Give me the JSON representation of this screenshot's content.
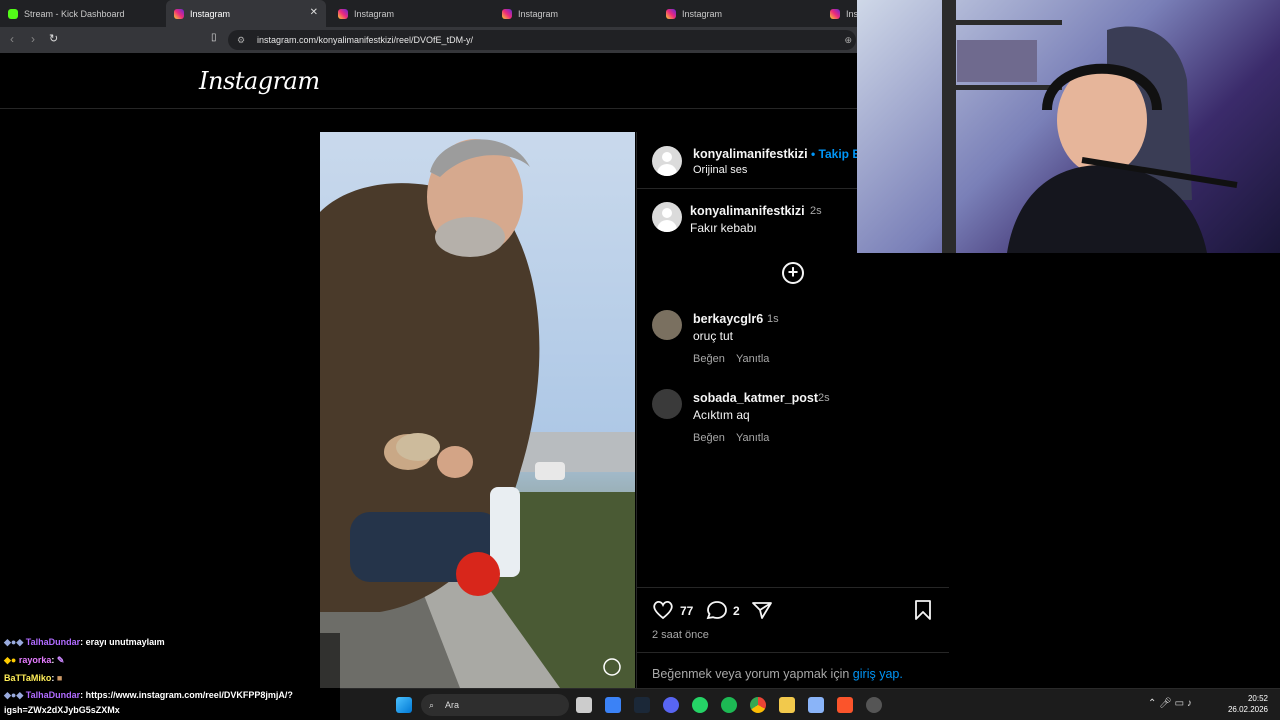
{
  "browser": {
    "tabs": [
      {
        "label": "Stream - Kick Dashboard",
        "icon": "kick-icon"
      },
      {
        "label": "Instagram",
        "icon": "instagram-icon"
      },
      {
        "label": "Instagram",
        "icon": "instagram-icon"
      },
      {
        "label": "Instagram",
        "icon": "instagram-icon"
      },
      {
        "label": "Instagram",
        "icon": "instagram-icon"
      },
      {
        "label": "Insta",
        "icon": "instagram-icon"
      }
    ],
    "active_tab_index": 1,
    "url": "instagram.com/konyalimanifestkizi/reel/DVOfE_tDM-y/"
  },
  "instagram": {
    "logo": "Instagram",
    "post": {
      "author": "konyalimanifestkizi",
      "follow_label": "• Takip E",
      "audio": "Orijinal ses",
      "caption_author": "konyalimanifestkizi",
      "caption_time": "2s",
      "caption": "Fakır kebabı",
      "comments": [
        {
          "user": "berkaycglr6",
          "time": "1s",
          "text": "oruç tut",
          "like": "Beğen",
          "reply": "Yanıtla"
        },
        {
          "user": "sobada_katmer_post",
          "time": "2s",
          "text": "Acıktım aq",
          "like": "Beğen",
          "reply": "Yanıtla"
        }
      ],
      "likes": "77",
      "comment_count": "2",
      "posted": "2 saat önce",
      "login_prompt": "Beğenmek veya yorum yapmak için",
      "login_link": "giriş yap."
    }
  },
  "chat": {
    "messages": [
      {
        "user": "TalhaDundar",
        "text": ": erayı unutmaylaım",
        "color": "#b06bff"
      },
      {
        "user": "rayorka",
        "text": ": ",
        "color": "#e57cff"
      },
      {
        "user": "BaTTaMiko",
        "text": ": ",
        "color": "#ffee58"
      },
      {
        "user": "TalhaDundar",
        "text": ": https://www.instagram.com/reel/DVKFPP8jmjA/?",
        "color": "#b06bff"
      },
      {
        "user": "",
        "text": "igsh=ZWx2dXJybG5sZXMx",
        "color": "#ffffff"
      }
    ]
  },
  "taskbar": {
    "search_placeholder": "Ara",
    "time": "20:52",
    "date": "26.02.2026"
  },
  "colors": {
    "accent": "#0095f6",
    "background": "#000000",
    "kick": "#53fc18"
  }
}
